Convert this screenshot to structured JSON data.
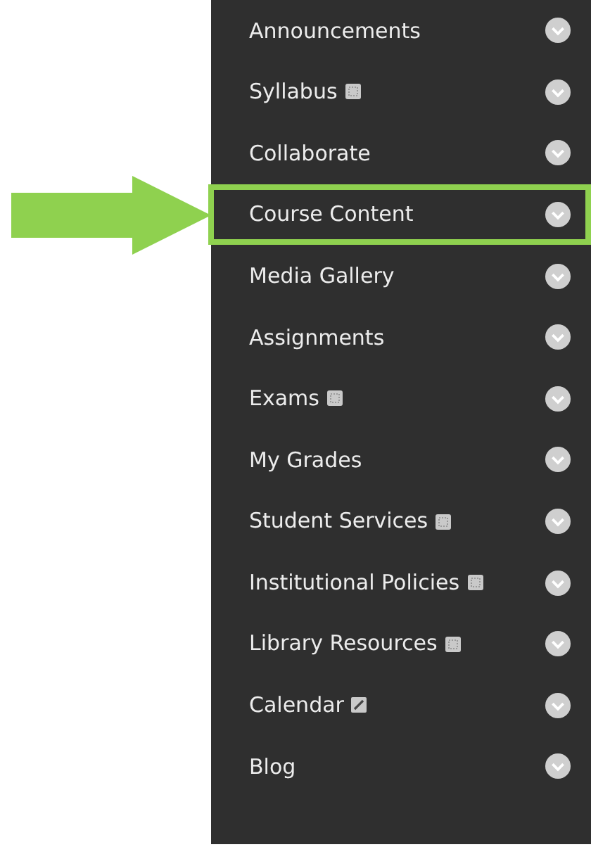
{
  "menu": [
    {
      "label": "Announcements",
      "selected": false,
      "kind": "plain"
    },
    {
      "label": "Syllabus",
      "selected": false,
      "kind": "page"
    },
    {
      "label": "Collaborate",
      "selected": false,
      "kind": "plain"
    },
    {
      "label": "Course Content",
      "selected": true,
      "kind": "plain"
    },
    {
      "label": "Media Gallery",
      "selected": false,
      "kind": "plain"
    },
    {
      "label": "Assignments",
      "selected": false,
      "kind": "plain"
    },
    {
      "label": "Exams",
      "selected": false,
      "kind": "page"
    },
    {
      "label": "My Grades",
      "selected": false,
      "kind": "plain"
    },
    {
      "label": "Student Services",
      "selected": false,
      "kind": "page"
    },
    {
      "label": "Institutional Policies",
      "selected": false,
      "kind": "page"
    },
    {
      "label": "Library Resources",
      "selected": false,
      "kind": "page"
    },
    {
      "label": "Calendar",
      "selected": false,
      "kind": "slash"
    },
    {
      "label": "Blog",
      "selected": false,
      "kind": "plain"
    }
  ]
}
